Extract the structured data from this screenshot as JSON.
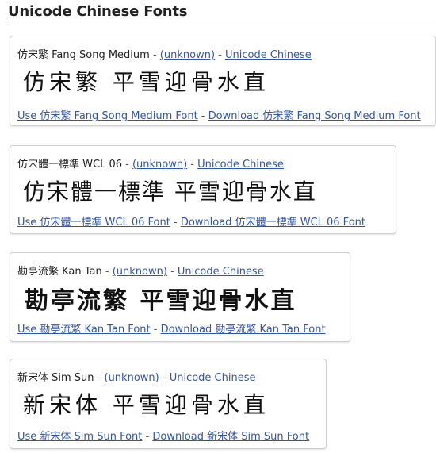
{
  "page_title": "Unicode Chinese Fonts",
  "separator": " - ",
  "fonts": [
    {
      "name": "仿宋繁 Fang Song Medium",
      "author": "(unknown)",
      "category": "Unicode Chinese",
      "sample": "仿宋繁  平雪迎骨水直",
      "use_link": "Use 仿宋繁 Fang Song Medium Font",
      "download_link": "Download 仿宋繁 Fang Song Medium Font"
    },
    {
      "name": "仿宋體一標準 WCL 06",
      "author": "(unknown)",
      "category": "Unicode Chinese",
      "sample": "仿宋體一標準  平雪迎骨水直",
      "use_link": "Use 仿宋體一標準 WCL 06 Font",
      "download_link": "Download 仿宋體一標準 WCL 06 Font"
    },
    {
      "name": "勘亭流繁 Kan Tan",
      "author": "(unknown)",
      "category": "Unicode Chinese",
      "sample": "勘亭流繁  平雪迎骨水直",
      "use_link": "Use 勘亭流繁 Kan Tan Font",
      "download_link": "Download 勘亭流繁 Kan Tan Font"
    },
    {
      "name": "新宋体 Sim Sun",
      "author": "(unknown)",
      "category": "Unicode Chinese",
      "sample": "新宋体  平雪迎骨水直",
      "use_link": "Use 新宋体 Sim Sun Font",
      "download_link": "Download 新宋体 Sim Sun Font"
    }
  ]
}
